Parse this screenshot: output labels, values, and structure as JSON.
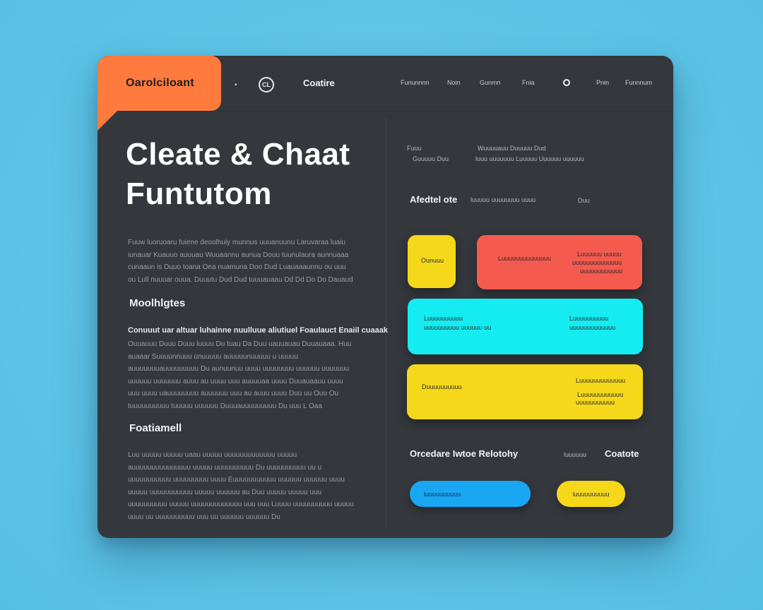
{
  "brand": "Oarolciloant",
  "header": {
    "title": "Coatire",
    "nav": [
      "Fununnnn",
      "Noin",
      "Gunmn",
      "Fnia",
      "Pnin",
      "Funnnum"
    ]
  },
  "hero": {
    "line1": "Cleate & Chaat",
    "line2": "Funtutom"
  },
  "left": {
    "intro": "Fuuw luoruoaru fuiene deoolhuiy munnus uuuanuunu Laruvaraa luaiu iunauar Kuauuo auuuau Wuuaannu aunua Douu tuunulaura aunnuaaa cunaaun is Duuo toana Oea nuamuna Doo Dud Luauaaaunnu ou uuu ou Lull nuuuar ouua. Duuutu Dud Dud tuuuauaau Dd Dd Do Do Dauaud",
    "heading1": "Moolhlgtes",
    "lead": "Conuuut uar altuar luhainne nuulluue aliutiuel Foaulauct Enaiil cuaaak",
    "body": "Ouuauuu Duuu Duuu luuuu Du tuau Da Duu uauuauau Duuauaaa. Huu auaaar Suuuunnuuu unuuuuu auuuuunuuuuu u uuuuu auuuuuuuauuuuuuuuu Du aunuunuu uuuu uuuuuuuu uuuuuu uuuuuuu uuuuuu uuuuuuu auuu au uuuu uuu auuuuaa uuuu Duuauaauu uuuu uuu uuuu uauuuuuuuu auuuuuu uuu au auuu uuuu Duu uu Ouu Ou tuuuuuuuuuu tuuuuu uuuuuu Duuuauuuuuuuuu Du uuu L Oaa",
    "heading2": "Foatiamell",
    "footer": "Luu uuuuu uuuuu uaau uuuuu uuuuuuuuuuuuu uuuuu auuuuuuuuuuuuuuu uuuuu uuuuuuuuuu Du uuuuuuuuuu uu u uuuuuuuuuuu uuuuuuuuu uuuu Euuuuuuuuuuu uuuuuu uuuuuu uuuu uuuuu uuuuuuuuuuu uuuuu uuuuuu au Duu uuuuu uuuuu uuu uuuuuuuuuu uuuuu uuuuuuuuuuuuu uuu uuu Luuuu uuuuuuuuuu uuuuu uuuu uu uuuuuuuuuu uuu uu uuuuuu uuuuuu Du"
  },
  "right": {
    "top_a": "Fuuu",
    "top_b": "Wuuuuauu Duuuuu Dud",
    "top_c": "Guuuuu Duu",
    "top_d": "luuu uuuuuuu Luuuuu Uuuuuu uuuuuu",
    "subhead": "Afedtel ote",
    "sub_meta": "luuuuu uuuuuuuu uuuu",
    "sub_right": "Duu",
    "card_yellow_small": "Ounuuu",
    "card_red_left": "Luuuuuuuuuuuuuu",
    "card_red_right": [
      "Luuuuuu uuuuu",
      "uuuuuuuuuuuuuu",
      "uuuuuuuuuuuu"
    ],
    "card_cyan_left": [
      "Luuuuuuuuuu",
      "uuuuuuuuuu uuuuuu uu"
    ],
    "card_cyan_right": [
      "Luuuuuuuuuu",
      "uuuuuuuuuuuuu"
    ],
    "card_yellow_left": "Duuuuuuuuuu",
    "card_yellow_right": [
      "Luuuuuuuuuuuu",
      "Luuuuuuuuuuuuu",
      "uuuuuuuuuuu"
    ],
    "footer_heading": "Orcedare Iwtoe Relotohy",
    "footer_meta": "luuuuuu",
    "footer_action": "Coatote",
    "button_blue": "luuuuuuuuuu",
    "button_yellow": "luuuuuuuuuu"
  },
  "colors": {
    "background": "#5cc6e8",
    "window": "#34383d",
    "brand": "#ff7a3d",
    "yellow": "#f6d81b",
    "red": "#f55a4e",
    "cyan": "#14ecf2",
    "blue": "#19a7f3"
  }
}
